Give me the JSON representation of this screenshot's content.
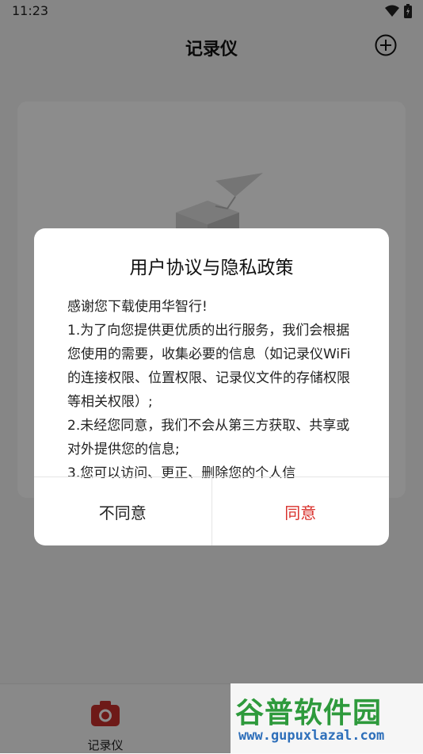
{
  "status": {
    "time": "11:23"
  },
  "app": {
    "title": "记录仪",
    "add_icon": "plus-circle-icon"
  },
  "bottom_nav": {
    "items": [
      {
        "label": "记录仪",
        "icon": "camera-icon",
        "color": "#c9302c"
      }
    ]
  },
  "dialog": {
    "title": "用户协议与隐私政策",
    "body": [
      "感谢您下载使用华智行!",
      "1.为了向您提供更优质的出行服务，我们会根据您使用的需要，收集必要的信息（如记录仪WiFi的连接权限、位置权限、记录仪文件的存储权限等相关权限）;",
      "2.未经您同意，我们不会从第三方获取、共享或对外提供您的信息;",
      "3.您可以访问、更正、删除您的个人信"
    ],
    "disagree_label": "不同意",
    "agree_label": "同意",
    "agree_color": "#d9302b"
  },
  "watermark": {
    "main": "谷普软件园",
    "url": "www.gupuxlazal.com"
  }
}
